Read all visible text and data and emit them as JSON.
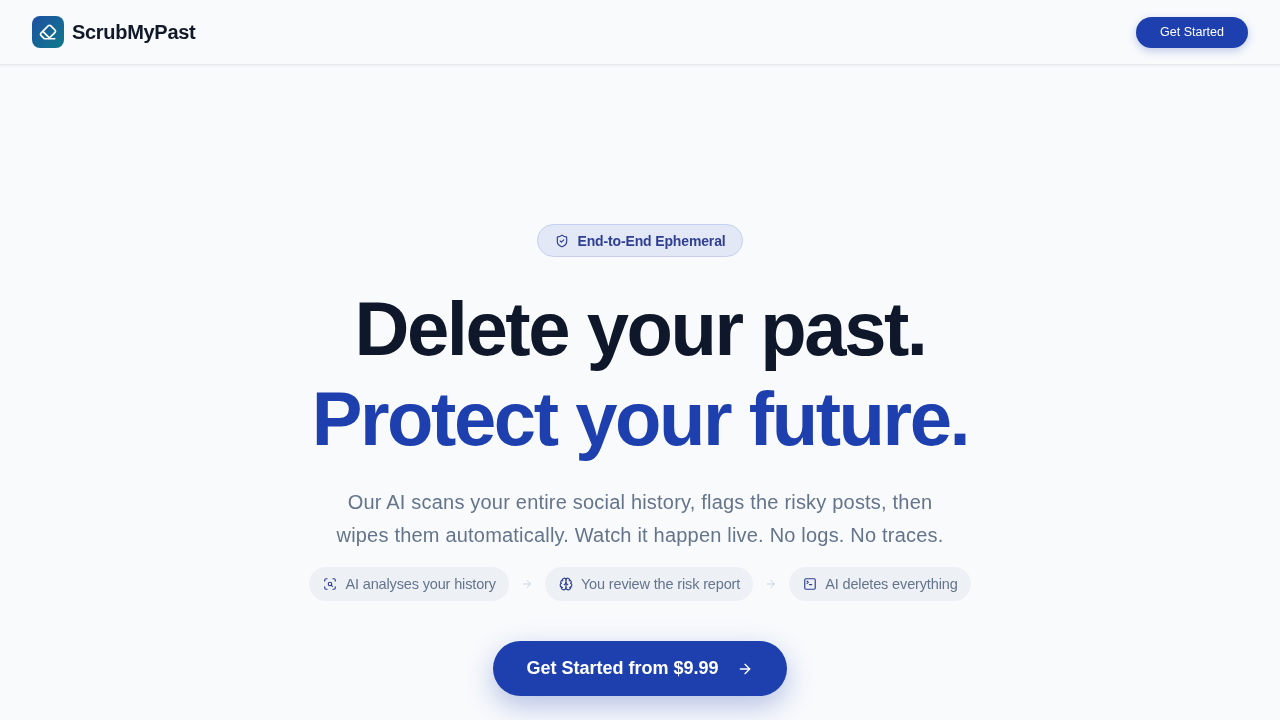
{
  "header": {
    "brand": "ScrubMyPast",
    "button": "Get Started"
  },
  "hero": {
    "badge": "End-to-End Ephemeral",
    "headline": [
      {
        "kind": "plain",
        "text": "Delete your past."
      },
      {
        "kind": "accent",
        "text": "Protect your future."
      }
    ],
    "description": "Our AI scans your entire social history, flags the risky posts, then wipes them automatically. Watch it happen live. No logs. No traces.",
    "steps": [
      "AI analyses your history",
      "You review the risk report",
      "AI deletes everything"
    ],
    "cta": "Get Started from $9.99"
  }
}
